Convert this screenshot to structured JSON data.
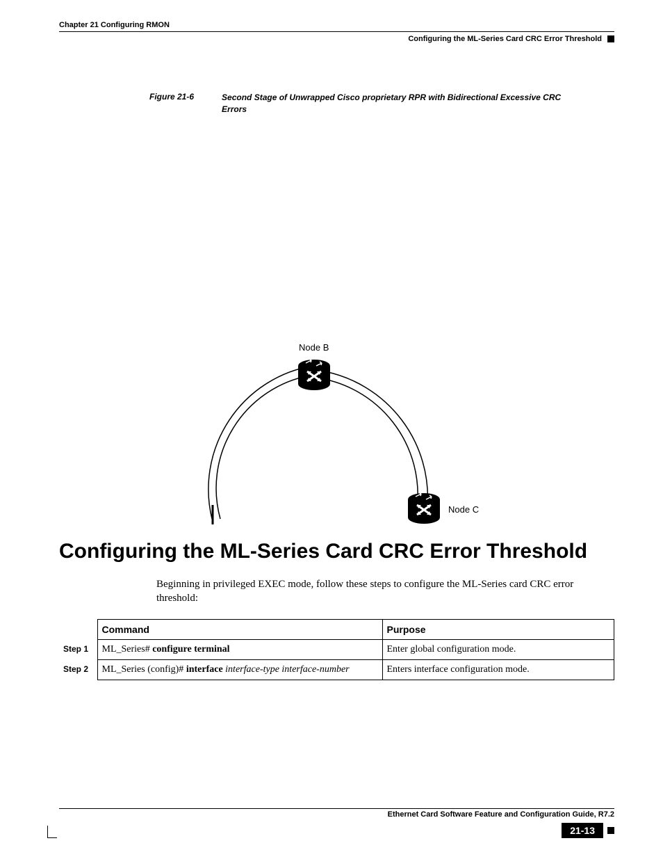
{
  "header": {
    "chapter": "Chapter 21  Configuring RMON",
    "section": "Configuring the ML-Series Card CRC Error Threshold"
  },
  "figure": {
    "label": "Figure 21-6",
    "title": "Second Stage of Unwrapped Cisco proprietary RPR  with Bidirectional Excessive CRC Errors",
    "node_b": "Node B",
    "node_c": "Node C"
  },
  "heading": "Configuring the ML-Series Card CRC Error Threshold",
  "intro": "Beginning in privileged EXEC mode, follow these steps to configure the ML-Series card CRC error threshold:",
  "table": {
    "head_command": "Command",
    "head_purpose": "Purpose",
    "rows": [
      {
        "step": "Step 1",
        "cmd_prefix": "ML_Series# ",
        "cmd_bold": "configure terminal",
        "cmd_italic": "",
        "purpose": "Enter global configuration mode."
      },
      {
        "step": "Step 2",
        "cmd_prefix": "ML_Series (config)# ",
        "cmd_bold": "interface",
        "cmd_italic": " interface-type interface-number",
        "purpose": "Enters interface configuration mode."
      }
    ]
  },
  "footer": {
    "guide": "Ethernet Card Software Feature and Configuration Guide, R7.2",
    "page": "21-13"
  }
}
